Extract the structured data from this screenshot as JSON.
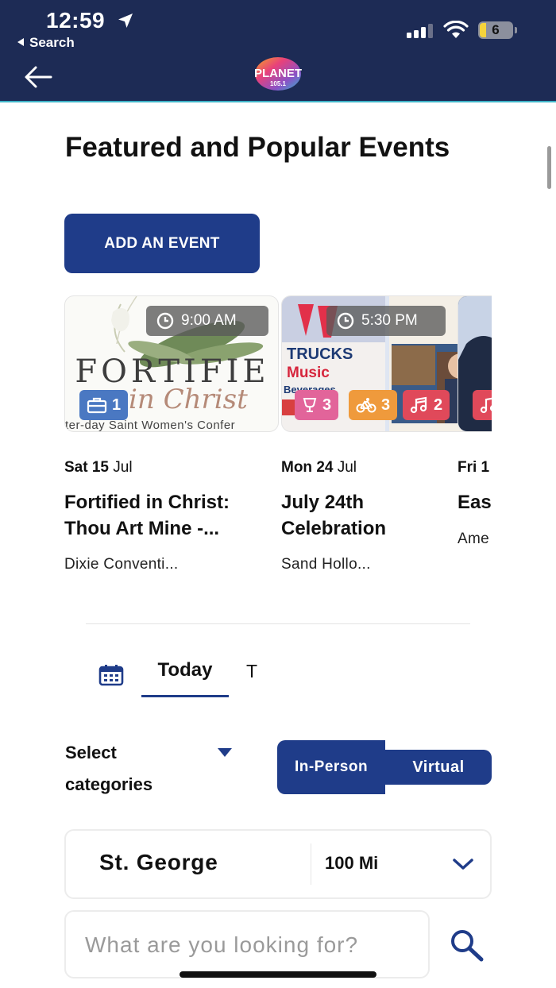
{
  "status_bar": {
    "time": "12:59",
    "back_app": "Search",
    "battery": "6"
  },
  "header": {
    "logo_text": "PLANET",
    "logo_sub": "105.1"
  },
  "page": {
    "title": "Featured and Popular Events",
    "add_event_label": "ADD AN EVENT"
  },
  "events": [
    {
      "time": "9:00 AM",
      "image_text": [
        "FORTIFIE",
        "in Christ",
        "ter-day Saint Women's Confer"
      ],
      "badges": [
        {
          "icon": "briefcase-icon",
          "count": "1",
          "color": "#4a78c2"
        }
      ],
      "date_day": "Sat 15",
      "date_month": "Jul",
      "title_lines": [
        "Fortified in Christ:",
        "Thou Art Mine -..."
      ],
      "venue": "Dixie Conventi..."
    },
    {
      "time": "5:30 PM",
      "image_text": [
        "TRUCKS",
        "Music",
        "Beverages"
      ],
      "badges": [
        {
          "icon": "award-icon",
          "count": "3",
          "color": "#e2649a"
        },
        {
          "icon": "bicycle-icon",
          "count": "3",
          "color": "#ef9a3c"
        },
        {
          "icon": "music-note-icon",
          "count": "2",
          "color": "#e0495a"
        }
      ],
      "date_day": "Mon 24",
      "date_month": "Jul",
      "title_lines": [
        "July 24th",
        "Celebration"
      ],
      "venue": "Sand Hollo..."
    },
    {
      "time": "",
      "image_text": [],
      "badges": [
        {
          "icon": "music-note-icon",
          "count": "",
          "color": "#e0495a"
        }
      ],
      "date_day": "Fri 1",
      "date_month": "",
      "title_lines": [
        "Eas"
      ],
      "venue": "Ame"
    }
  ],
  "date_tabs": {
    "active": "Today",
    "next_partial": "T"
  },
  "filters": {
    "categories_label": "Select categories",
    "toggle": {
      "in_person": "In-Person",
      "virtual": "Virtual"
    }
  },
  "location": {
    "city": "St. George",
    "radius": "100 Mi"
  },
  "search": {
    "placeholder": "What are you looking for?"
  },
  "colors": {
    "header_bg": "#1d2b55",
    "accent": "#1f3c89"
  }
}
